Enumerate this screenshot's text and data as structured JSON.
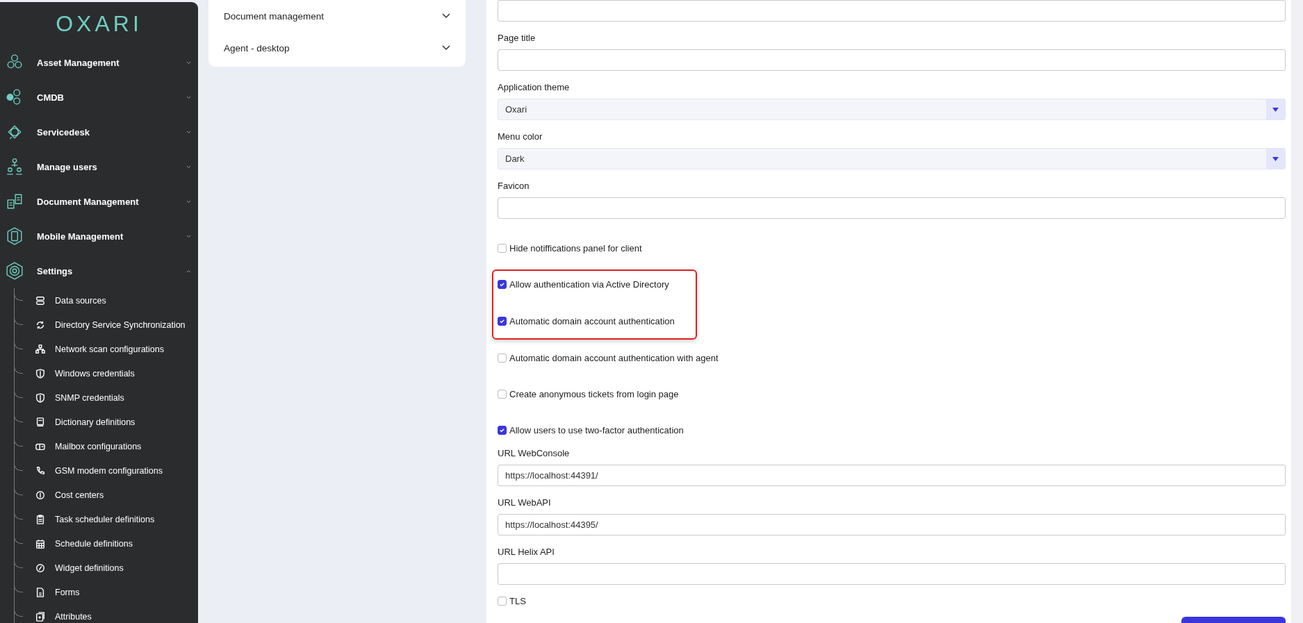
{
  "sidebar": {
    "logo": "OXARI",
    "items": [
      {
        "label": "Asset Management",
        "expanded": false
      },
      {
        "label": "CMDB",
        "expanded": false
      },
      {
        "label": "Servicedesk",
        "expanded": false
      },
      {
        "label": "Manage users",
        "expanded": false
      },
      {
        "label": "Document Management",
        "expanded": false
      },
      {
        "label": "Mobile Management",
        "expanded": false
      },
      {
        "label": "Settings",
        "expanded": true,
        "children": [
          {
            "label": "Data sources"
          },
          {
            "label": "Directory Service Synchronization"
          },
          {
            "label": "Network scan configurations"
          },
          {
            "label": "Windows credentials"
          },
          {
            "label": "SNMP credentials"
          },
          {
            "label": "Dictionary definitions"
          },
          {
            "label": "Mailbox configurations"
          },
          {
            "label": "GSM modem configurations"
          },
          {
            "label": "Cost centers"
          },
          {
            "label": "Task scheduler definitions"
          },
          {
            "label": "Schedule definitions"
          },
          {
            "label": "Widget definitions"
          },
          {
            "label": "Forms"
          },
          {
            "label": "Attributes"
          }
        ]
      }
    ]
  },
  "sections": [
    {
      "label": "Document management",
      "expanded": false
    },
    {
      "label": "Agent - desktop",
      "expanded": false
    }
  ],
  "form": {
    "items": [
      {
        "kind": "text"
      },
      {
        "kind": "text",
        "label": "Page title"
      },
      {
        "kind": "select",
        "label": "Application theme",
        "value": "Oxari"
      },
      {
        "kind": "select",
        "label": "Menu color",
        "value": "Dark"
      },
      {
        "kind": "text",
        "label": "Favicon"
      },
      {
        "kind": "checkbox",
        "label": "Hide notiffications panel for client",
        "checked": false,
        "highlighted": false
      },
      {
        "kind": "checkbox",
        "label": "Allow authentication via Active Directory",
        "checked": true,
        "highlighted": true
      },
      {
        "kind": "checkbox",
        "label": "Automatic domain account authentication",
        "checked": true,
        "highlighted": true
      },
      {
        "kind": "checkbox",
        "label": "Automatic domain account authentication with agent",
        "checked": false,
        "highlighted": false
      },
      {
        "kind": "checkbox",
        "label": "Create anonymous tickets from login page",
        "checked": false,
        "highlighted": false
      },
      {
        "kind": "checkbox",
        "label": "Allow users to use two-factor authentication",
        "checked": true,
        "highlighted": false
      },
      {
        "kind": "text",
        "label": "URL WebConsole",
        "value": "https://localhost:44391/"
      },
      {
        "kind": "text",
        "label": "URL WebAPI",
        "value": "https://localhost:44395/"
      },
      {
        "kind": "text",
        "label": "URL Helix API"
      },
      {
        "kind": "checkbox",
        "label": "TLS",
        "checked": false,
        "highlighted": false
      }
    ],
    "submit": {
      "kind": "button"
    }
  }
}
